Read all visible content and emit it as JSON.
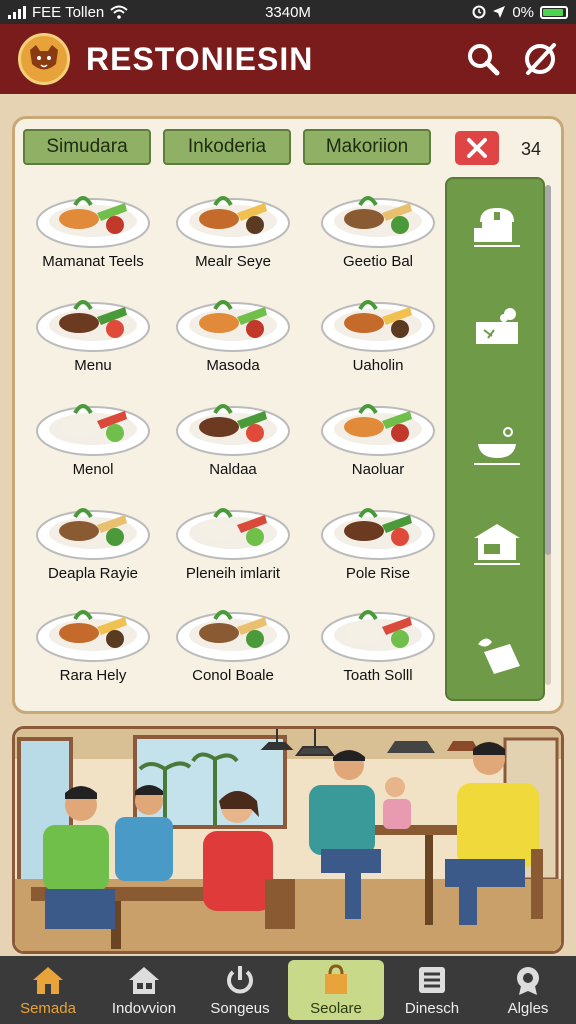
{
  "status_bar": {
    "carrier": "FEE Tollen",
    "time": "3340M",
    "battery": "0%",
    "battery_level": 0.85
  },
  "header": {
    "title": "RESTONIESIN",
    "search_icon": "search-icon",
    "action_icon": "slashed-circle-icon"
  },
  "tabs": [
    {
      "label": "Simudara"
    },
    {
      "label": "Inkoderia"
    },
    {
      "label": "Makoriion"
    }
  ],
  "close_icon": "close-icon",
  "item_count": "34",
  "menu_items": [
    {
      "label": "Mamanat Teels"
    },
    {
      "label": "Mealr Seye"
    },
    {
      "label": "Geetio Bal"
    },
    {
      "label": "Menu"
    },
    {
      "label": "Masoda"
    },
    {
      "label": "Uaholin"
    },
    {
      "label": "Menol"
    },
    {
      "label": "Naldaa"
    },
    {
      "label": "Naoluar"
    },
    {
      "label": "Deapla Rayie"
    },
    {
      "label": "Pleneih imlarit"
    },
    {
      "label": "Pole Rise"
    },
    {
      "label": "Rara Hely"
    },
    {
      "label": "Conol Boale"
    },
    {
      "label": "Toath Solll"
    }
  ],
  "side_rail_icons": [
    "store-icon",
    "cake-icon",
    "bowl-icon",
    "shop-icon",
    "food-tag-icon"
  ],
  "tabbar": [
    {
      "label": "Semada",
      "icon": "home-icon"
    },
    {
      "label": "Indovvion",
      "icon": "house-icon"
    },
    {
      "label": "Songeus",
      "icon": "power-icon"
    },
    {
      "label": "Seolare",
      "icon": "bag-icon"
    },
    {
      "label": "Dinesch",
      "icon": "list-icon"
    },
    {
      "label": "Algles",
      "icon": "badge-icon"
    }
  ],
  "colors": {
    "header": "#7a1c1c",
    "accent_green": "#6f9a48",
    "tab_green": "#8fb065",
    "close_red": "#e04545",
    "tabbar_bg": "#3a3a3a",
    "active_tab": "#c9d98a"
  }
}
